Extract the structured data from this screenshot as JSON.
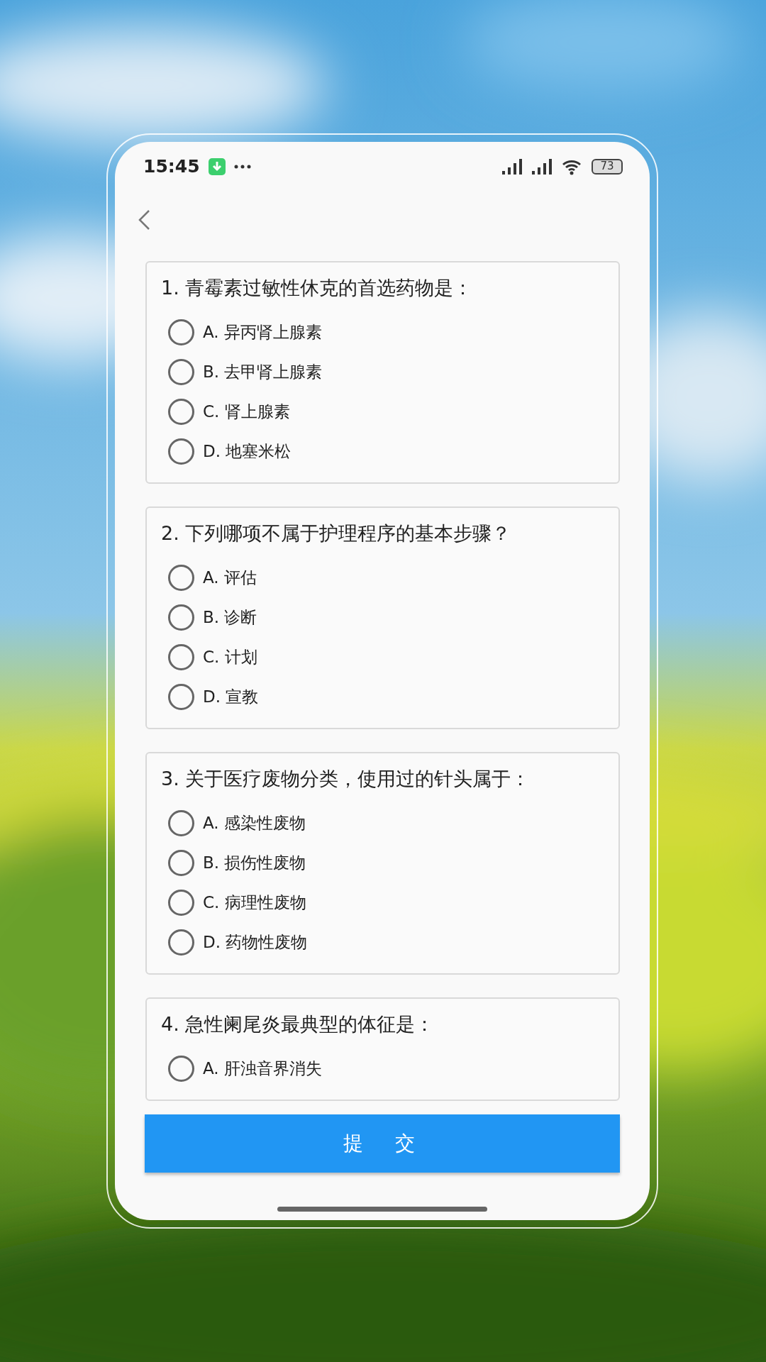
{
  "status_bar": {
    "time": "15:45",
    "battery": "73"
  },
  "questions": [
    {
      "title": "1. 青霉素过敏性休克的首选药物是：",
      "options": [
        {
          "label": "A. 异丙肾上腺素",
          "selected": false
        },
        {
          "label": "B. 去甲肾上腺素",
          "selected": false
        },
        {
          "label": "C. 肾上腺素",
          "selected": false
        },
        {
          "label": "D. 地塞米松",
          "selected": false
        }
      ]
    },
    {
      "title": "2. 下列哪项不属于护理程序的基本步骤？",
      "options": [
        {
          "label": "A. 评估",
          "selected": false
        },
        {
          "label": "B. 诊断",
          "selected": false
        },
        {
          "label": "C. 计划",
          "selected": false
        },
        {
          "label": "D. 宣教",
          "selected": false
        }
      ]
    },
    {
      "title": "3. 关于医疗废物分类，使用过的针头属于：",
      "options": [
        {
          "label": "A. 感染性废物",
          "selected": false
        },
        {
          "label": "B. 损伤性废物",
          "selected": false
        },
        {
          "label": "C. 病理性废物",
          "selected": false
        },
        {
          "label": "D. 药物性废物",
          "selected": false
        }
      ]
    },
    {
      "title": "4. 急性阑尾炎最典型的体征是：",
      "options": [
        {
          "label": "A. 肝浊音界消失",
          "selected": false
        }
      ]
    }
  ],
  "submit_button": "提　交"
}
